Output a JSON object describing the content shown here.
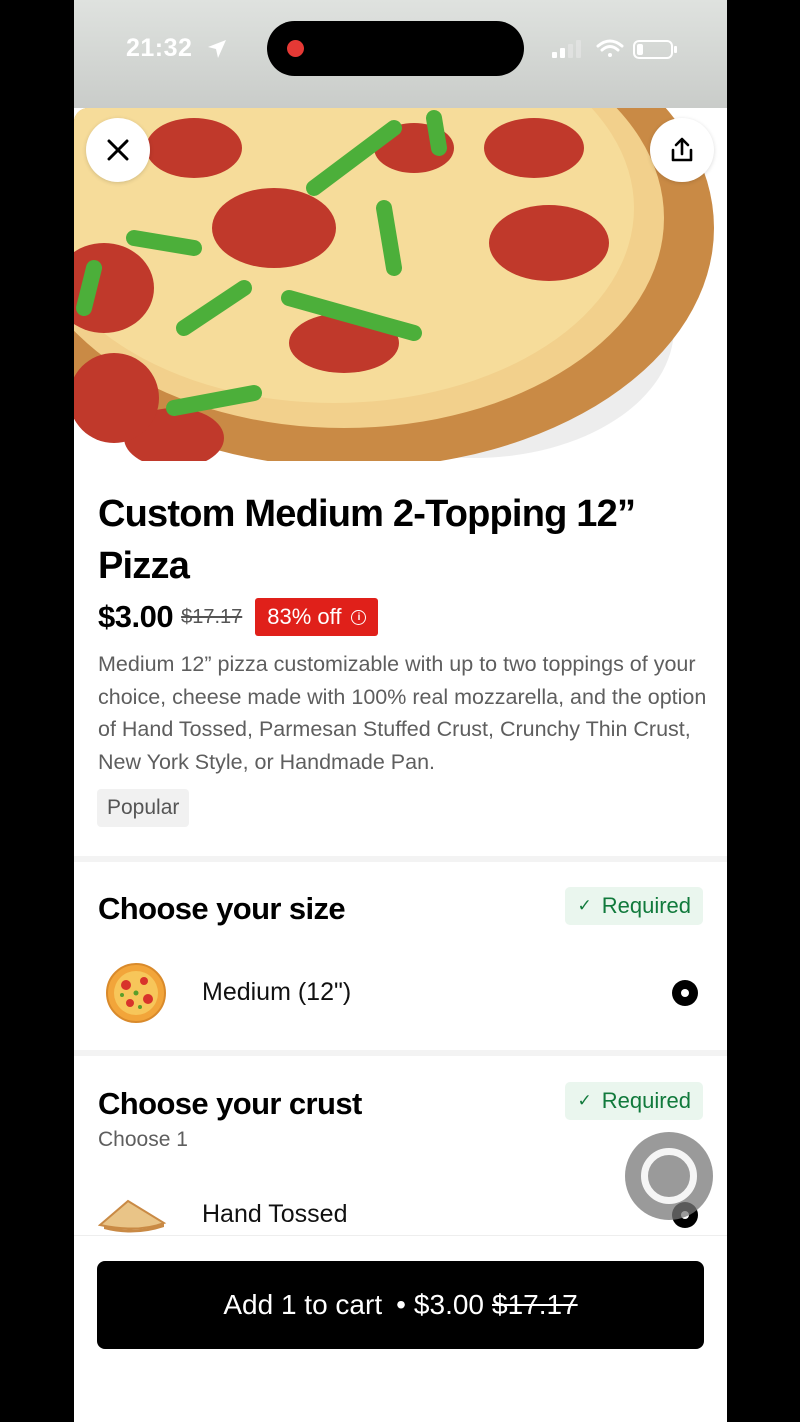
{
  "status_bar": {
    "time": "21:32"
  },
  "hero": {
    "close_icon": "close-icon",
    "share_icon": "share-icon"
  },
  "item": {
    "title": "Custom Medium 2-Topping 12” Pizza",
    "price": "$3.00",
    "original_price": "$17.17",
    "discount": "83% off",
    "description": "Medium 12” pizza customizable with up to two toppings of your choice, cheese made with 100% real mozzarella, and the option of Hand Tossed, Parmesan Stuffed Crust, Crunchy Thin Crust, New York Style, or Handmade Pan.",
    "badge": "Popular"
  },
  "size_section": {
    "title": "Choose your size",
    "required": "Required",
    "options": [
      {
        "label": "Medium (12\")",
        "selected": true
      }
    ]
  },
  "crust_section": {
    "title": "Choose your crust",
    "subtitle": "Choose 1",
    "required": "Required",
    "options": [
      {
        "label": "Hand Tossed",
        "selected": true
      }
    ]
  },
  "cart_button": {
    "label": "Add 1 to cart",
    "separator": "•",
    "price": "$3.00",
    "original_price": "$17.17"
  },
  "colors": {
    "discount_bg": "#e0201a",
    "required_bg": "#eaf6ee",
    "required_text": "#117a3c",
    "button_bg": "#000000"
  }
}
